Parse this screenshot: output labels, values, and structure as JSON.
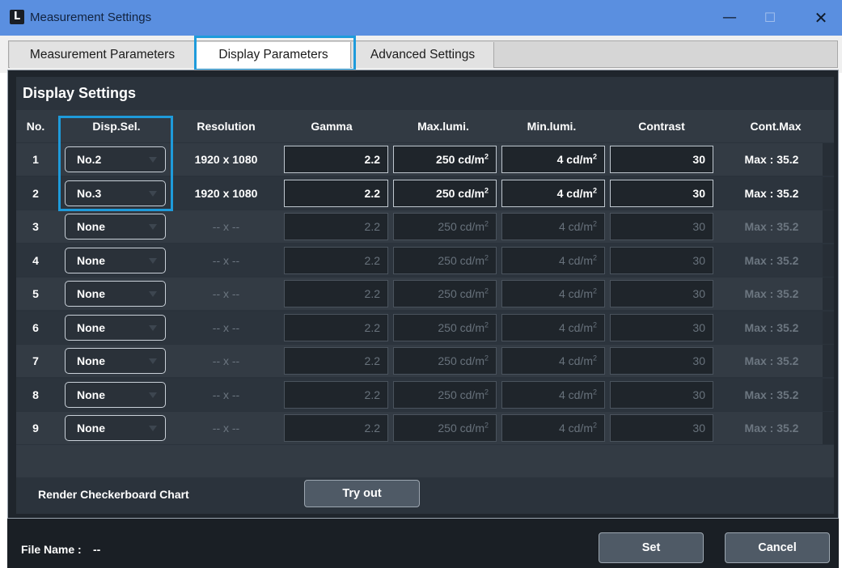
{
  "window": {
    "title": "Measurement Settings",
    "icon_letter": "L",
    "min_symbol": "—",
    "max_symbol": "☐",
    "close_symbol": "✕"
  },
  "tabs": [
    {
      "label": "Measurement Parameters",
      "active": false
    },
    {
      "label": "Display Parameters",
      "active": true
    },
    {
      "label": "Advanced Settings",
      "active": false
    }
  ],
  "panel": {
    "title": "Display Settings",
    "columns": [
      "No.",
      "Disp.Sel.",
      "Resolution",
      "Gamma",
      "Max.lumi.",
      "Min.lumi.",
      "Contrast",
      "Cont.Max"
    ],
    "rows": [
      {
        "no": "1",
        "disp": "No.2",
        "resolution": "1920 x 1080",
        "gamma": "2.2",
        "max": "250 cd/m",
        "min": "4 cd/m",
        "contrast": "30",
        "contmax": "Max : 35.2",
        "enabled": true
      },
      {
        "no": "2",
        "disp": "No.3",
        "resolution": "1920 x 1080",
        "gamma": "2.2",
        "max": "250 cd/m",
        "min": "4 cd/m",
        "contrast": "30",
        "contmax": "Max : 35.2",
        "enabled": true
      },
      {
        "no": "3",
        "disp": "None",
        "resolution": "-- x --",
        "gamma": "2.2",
        "max": "250 cd/m",
        "min": "4 cd/m",
        "contrast": "30",
        "contmax": "Max : 35.2",
        "enabled": false
      },
      {
        "no": "4",
        "disp": "None",
        "resolution": "-- x --",
        "gamma": "2.2",
        "max": "250 cd/m",
        "min": "4 cd/m",
        "contrast": "30",
        "contmax": "Max : 35.2",
        "enabled": false
      },
      {
        "no": "5",
        "disp": "None",
        "resolution": "-- x --",
        "gamma": "2.2",
        "max": "250 cd/m",
        "min": "4 cd/m",
        "contrast": "30",
        "contmax": "Max : 35.2",
        "enabled": false
      },
      {
        "no": "6",
        "disp": "None",
        "resolution": "-- x --",
        "gamma": "2.2",
        "max": "250 cd/m",
        "min": "4 cd/m",
        "contrast": "30",
        "contmax": "Max : 35.2",
        "enabled": false
      },
      {
        "no": "7",
        "disp": "None",
        "resolution": "-- x --",
        "gamma": "2.2",
        "max": "250 cd/m",
        "min": "4 cd/m",
        "contrast": "30",
        "contmax": "Max : 35.2",
        "enabled": false
      },
      {
        "no": "8",
        "disp": "None",
        "resolution": "-- x --",
        "gamma": "2.2",
        "max": "250 cd/m",
        "min": "4 cd/m",
        "contrast": "30",
        "contmax": "Max : 35.2",
        "enabled": false
      },
      {
        "no": "9",
        "disp": "None",
        "resolution": "-- x --",
        "gamma": "2.2",
        "max": "250 cd/m",
        "min": "4 cd/m",
        "contrast": "30",
        "contmax": "Max : 35.2",
        "enabled": false
      }
    ],
    "unit_superscript": "2",
    "render_label": "Render Checkerboard Chart",
    "try_out_label": "Try out"
  },
  "footer": {
    "file_name_label": "File Name :",
    "file_name_value": "--",
    "set_label": "Set",
    "cancel_label": "Cancel"
  },
  "colors": {
    "title_bar": "#5a8fe0",
    "highlight": "#1e9bdb",
    "panel_bg": "#2b333c"
  }
}
